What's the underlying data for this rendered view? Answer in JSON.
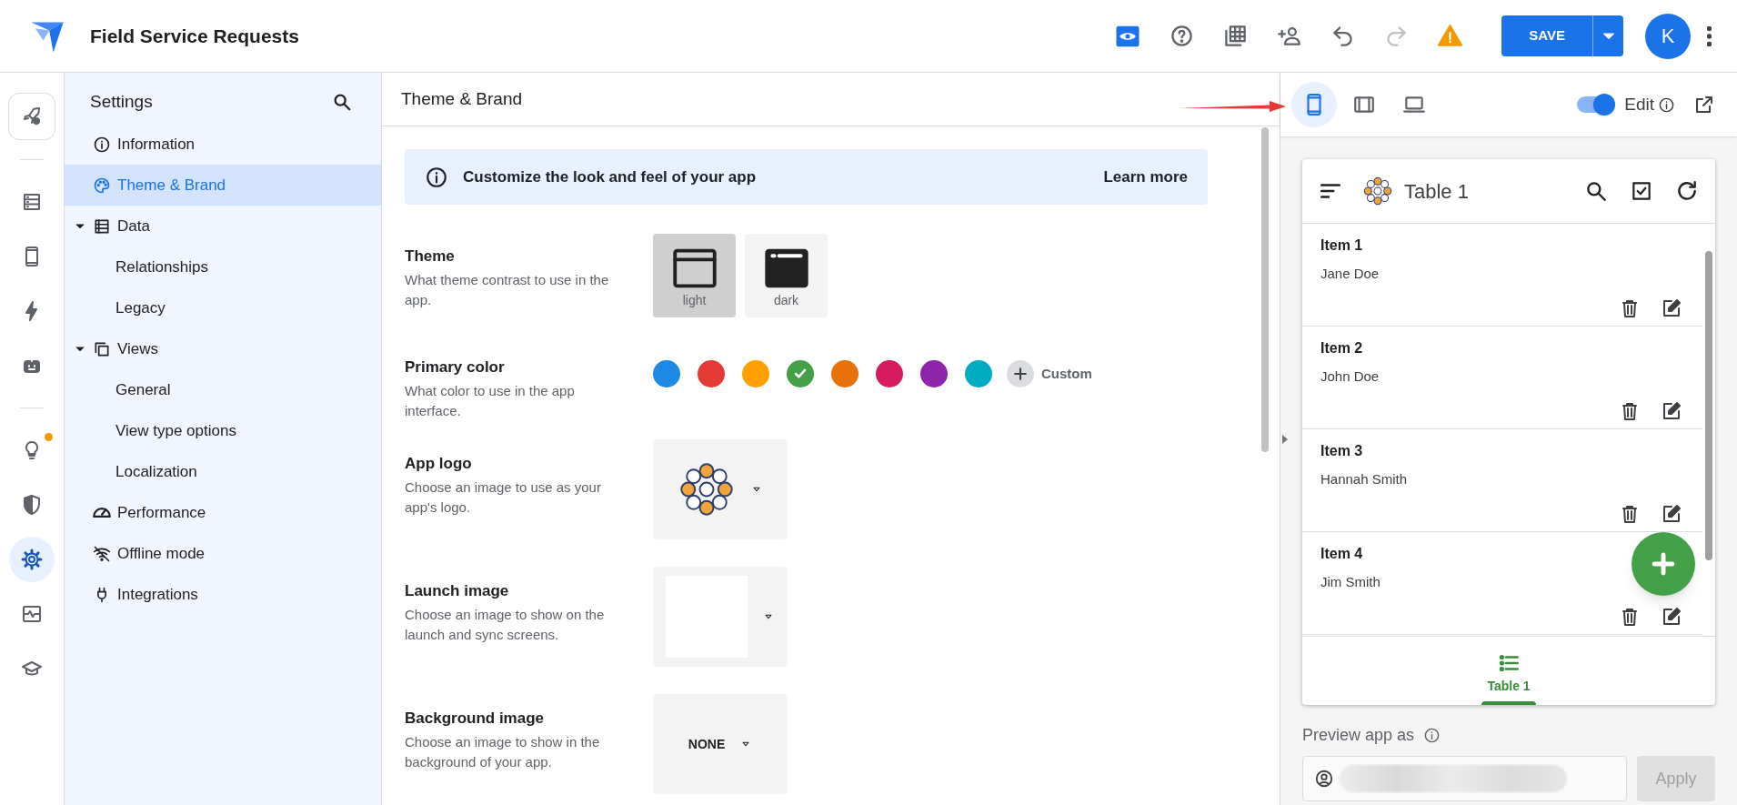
{
  "app_bar": {
    "title": "Field Service Requests",
    "save_label": "SAVE",
    "avatar_initial": "K",
    "tools": [
      {
        "kind": "preview",
        "selected": true,
        "disabled": false
      },
      {
        "kind": "help",
        "selected": false,
        "disabled": false
      },
      {
        "kind": "sheets",
        "selected": false,
        "disabled": false
      },
      {
        "kind": "share",
        "selected": false,
        "disabled": false
      },
      {
        "kind": "undo",
        "selected": false,
        "disabled": false
      },
      {
        "kind": "redo",
        "selected": false,
        "disabled": true
      },
      {
        "kind": "warning",
        "selected": false,
        "disabled": false
      }
    ]
  },
  "rail": {
    "groups": [
      {
        "items": [
          {
            "kind": "rocket",
            "selected": false,
            "dot": false
          }
        ]
      },
      {
        "items": [
          {
            "kind": "data",
            "selected": false,
            "dot": false
          },
          {
            "kind": "phone",
            "selected": false,
            "dot": false
          },
          {
            "kind": "bolt",
            "selected": false,
            "dot": false
          },
          {
            "kind": "robot",
            "selected": false,
            "dot": false
          }
        ]
      },
      {
        "items": [
          {
            "kind": "bulb",
            "selected": false,
            "dot": true
          },
          {
            "kind": "shield",
            "selected": false,
            "dot": false
          },
          {
            "kind": "gear",
            "selected": true,
            "dot": false
          },
          {
            "kind": "monitor",
            "selected": false,
            "dot": false
          },
          {
            "kind": "school",
            "selected": false,
            "dot": false
          }
        ]
      }
    ]
  },
  "settings_nav": {
    "title": "Settings",
    "items": [
      {
        "label": "Information",
        "kind": "info",
        "selected": false
      },
      {
        "label": "Theme & Brand",
        "kind": "palette",
        "selected": true
      },
      {
        "label": "Data",
        "kind": "table",
        "selected": false,
        "expanded": true,
        "children": [
          {
            "label": "Relationships",
            "selected": false
          },
          {
            "label": "Legacy",
            "selected": false
          }
        ]
      },
      {
        "label": "Views",
        "kind": "views",
        "selected": false,
        "expanded": true,
        "children": [
          {
            "label": "General",
            "selected": false
          },
          {
            "label": "View type options",
            "selected": false
          },
          {
            "label": "Localization",
            "selected": false
          }
        ]
      },
      {
        "label": "Performance",
        "kind": "gauge",
        "selected": false
      },
      {
        "label": "Offline mode",
        "kind": "offline",
        "selected": false
      },
      {
        "label": "Integrations",
        "kind": "plug",
        "selected": false
      }
    ]
  },
  "main": {
    "title": "Theme & Brand",
    "banner": {
      "text": "Customize the look and feel of your app",
      "link": "Learn more"
    },
    "sections": [
      {
        "kind": "theme",
        "label": "Theme",
        "description": "What theme contrast to use in the app.",
        "options": [
          {
            "kind": "light",
            "label": "light",
            "selected": true
          },
          {
            "kind": "dark",
            "label": "dark",
            "selected": false
          }
        ]
      },
      {
        "kind": "colors",
        "label": "Primary color",
        "description": "What color to use in the app interface.",
        "custom_label": "Custom",
        "swatches": [
          {
            "color": "#1e88e5",
            "selected": false
          },
          {
            "color": "#e53935",
            "selected": false
          },
          {
            "color": "#ffa000",
            "selected": false
          },
          {
            "color": "#43a047",
            "selected": true
          },
          {
            "color": "#e8710a",
            "selected": false
          },
          {
            "color": "#d81b60",
            "selected": false
          },
          {
            "color": "#8e24aa",
            "selected": false
          },
          {
            "color": "#00acc1",
            "selected": false
          }
        ]
      },
      {
        "kind": "logo",
        "label": "App logo",
        "description": "Choose an image to use as your app's logo."
      },
      {
        "kind": "blank",
        "label": "Launch image",
        "description": "Choose an image to show on the launch and sync screens."
      },
      {
        "kind": "none",
        "label": "Background image",
        "description": "Choose an image to show in the background of your app.",
        "value": "NONE"
      }
    ]
  },
  "preview": {
    "devices": [
      {
        "kind": "phone",
        "selected": true
      },
      {
        "kind": "tablet",
        "selected": false
      },
      {
        "kind": "desktop",
        "selected": false
      }
    ],
    "edit_toggle": {
      "label": "Edit",
      "on": true
    },
    "app": {
      "title": "Table 1",
      "rows": [
        {
          "title": "Item 1",
          "subtitle": "Jane Doe"
        },
        {
          "title": "Item 2",
          "subtitle": "John Doe"
        },
        {
          "title": "Item 3",
          "subtitle": "Hannah Smith"
        },
        {
          "title": "Item 4",
          "subtitle": "Jim Smith"
        }
      ],
      "nav": [
        {
          "label": "Table 1",
          "selected": true
        }
      ]
    },
    "preview_as": {
      "label": "Preview app as",
      "button": "Apply"
    }
  }
}
